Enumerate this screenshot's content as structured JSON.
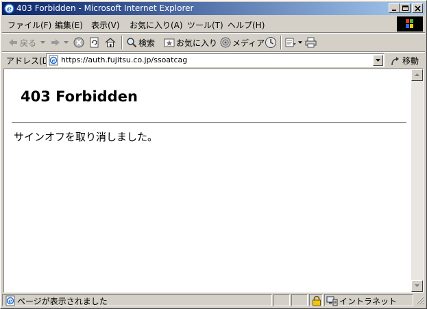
{
  "window": {
    "title": "403 Forbidden - Microsoft Internet Explorer",
    "controls": [
      "minimize",
      "maximize",
      "close"
    ]
  },
  "menubar": {
    "items": [
      {
        "label": "ファイル(F)"
      },
      {
        "label": "編集(E)"
      },
      {
        "label": "表示(V)"
      },
      {
        "label": "お気に入り(A)"
      },
      {
        "label": "ツール(T)"
      },
      {
        "label": "ヘルプ(H)"
      }
    ]
  },
  "toolbar": {
    "back_label": "戻る",
    "search_label": "検索",
    "favorites_label": "お気に入り",
    "media_label": "メディア",
    "icons": [
      "back-arrow-icon",
      "forward-arrow-icon",
      "stop-icon",
      "refresh-icon",
      "home-icon",
      "search-icon",
      "favorites-icon",
      "media-icon",
      "history-icon",
      "mail-icon",
      "print-icon"
    ]
  },
  "addressbar": {
    "label": "アドレス(D)",
    "url": "https://auth.fujitsu.co.jp/ssoatcag",
    "go_label": "移動"
  },
  "page": {
    "heading": "403 Forbidden",
    "message": "サインオフを取り消しました。"
  },
  "statusbar": {
    "text": "ページが表示されました",
    "zone": "イントラネット"
  },
  "colors": {
    "titlebar_start": "#0a246a",
    "titlebar_end": "#a6caf0",
    "chrome": "#d4d0c8",
    "content_bg": "#ffffff"
  }
}
